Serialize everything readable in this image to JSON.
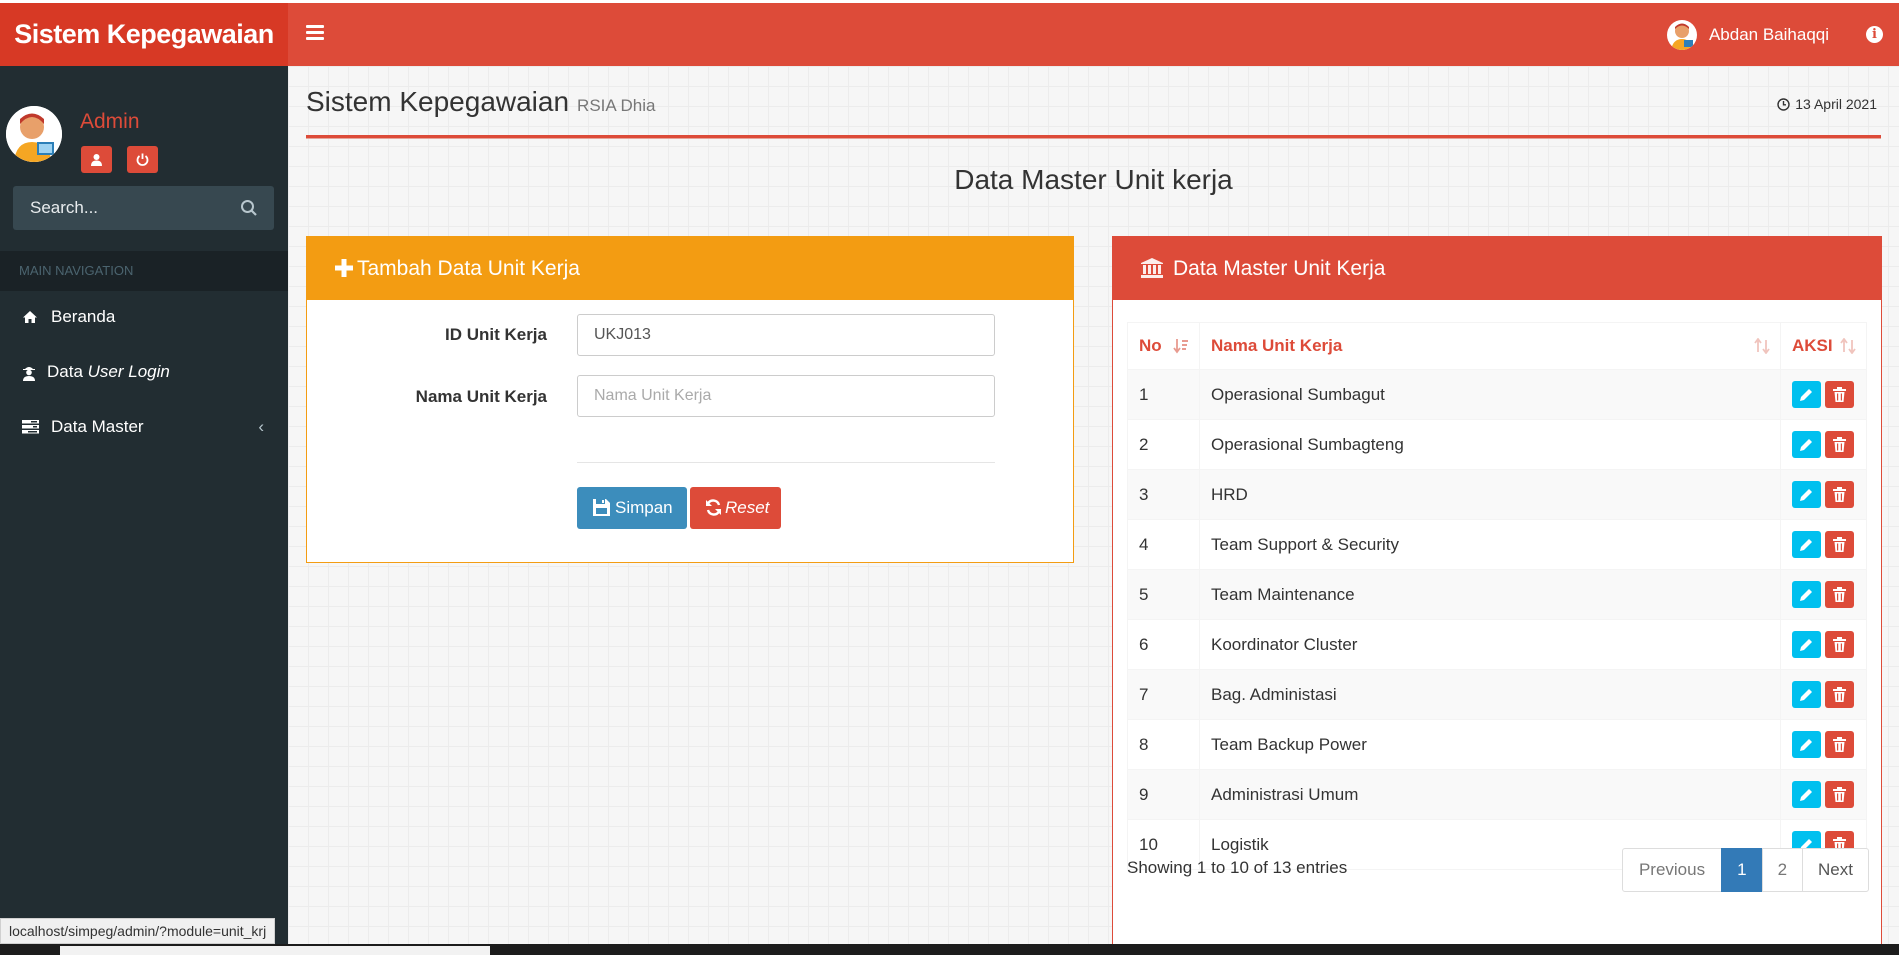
{
  "app": {
    "logo": "Sistem  Kepegawaian"
  },
  "navbar": {
    "user_name": "Abdan Baihaqqi"
  },
  "sidebar": {
    "user_name": "Admin",
    "search_placeholder": "Search...",
    "nav_header": "MAIN NAVIGATION",
    "items": [
      {
        "label": "Beranda",
        "icon": "home-icon"
      },
      {
        "label_prefix": "Data ",
        "label_italic": "User Login",
        "icon": "user-secret-icon"
      },
      {
        "label": "Data Master",
        "icon": "tasks-icon"
      }
    ]
  },
  "page": {
    "title": "Sistem Kepegawaian",
    "subtitle": "RSIA Dhia",
    "date": "13 April 2021",
    "section_title": "Data Master Unit kerja"
  },
  "form": {
    "title": "Tambah Data Unit Kerja",
    "id_label": "ID Unit Kerja",
    "id_value": "UKJ013",
    "name_label": "Nama Unit Kerja",
    "name_placeholder": "Nama Unit Kerja",
    "save_label": "Simpan",
    "reset_label": "Reset"
  },
  "table_box": {
    "title": "Data Master Unit Kerja",
    "columns": [
      "No",
      "Nama Unit Kerja",
      "AKSI"
    ],
    "rows": [
      {
        "no": "1",
        "name": "Operasional Sumbagut"
      },
      {
        "no": "2",
        "name": "Operasional Sumbagteng"
      },
      {
        "no": "3",
        "name": "HRD"
      },
      {
        "no": "4",
        "name": "Team Support & Security"
      },
      {
        "no": "5",
        "name": "Team Maintenance"
      },
      {
        "no": "6",
        "name": "Koordinator Cluster"
      },
      {
        "no": "7",
        "name": "Bag. Administasi"
      },
      {
        "no": "8",
        "name": "Team Backup Power"
      },
      {
        "no": "9",
        "name": "Administrasi Umum"
      },
      {
        "no": "10",
        "name": "Logistik"
      }
    ],
    "info": "Showing 1 to 10 of 13 entries",
    "pagination": {
      "previous": "Previous",
      "pages": [
        "1",
        "2"
      ],
      "next": "Next",
      "active_page": "1"
    }
  },
  "statusbar": {
    "url": "localhost/simpeg/admin/?module=unit_krj"
  },
  "colors": {
    "primary_red": "#dd4b39",
    "warning": "#f39c12",
    "sidebar": "#222d32",
    "info": "#00c0ef",
    "blue": "#3c8dbc"
  }
}
